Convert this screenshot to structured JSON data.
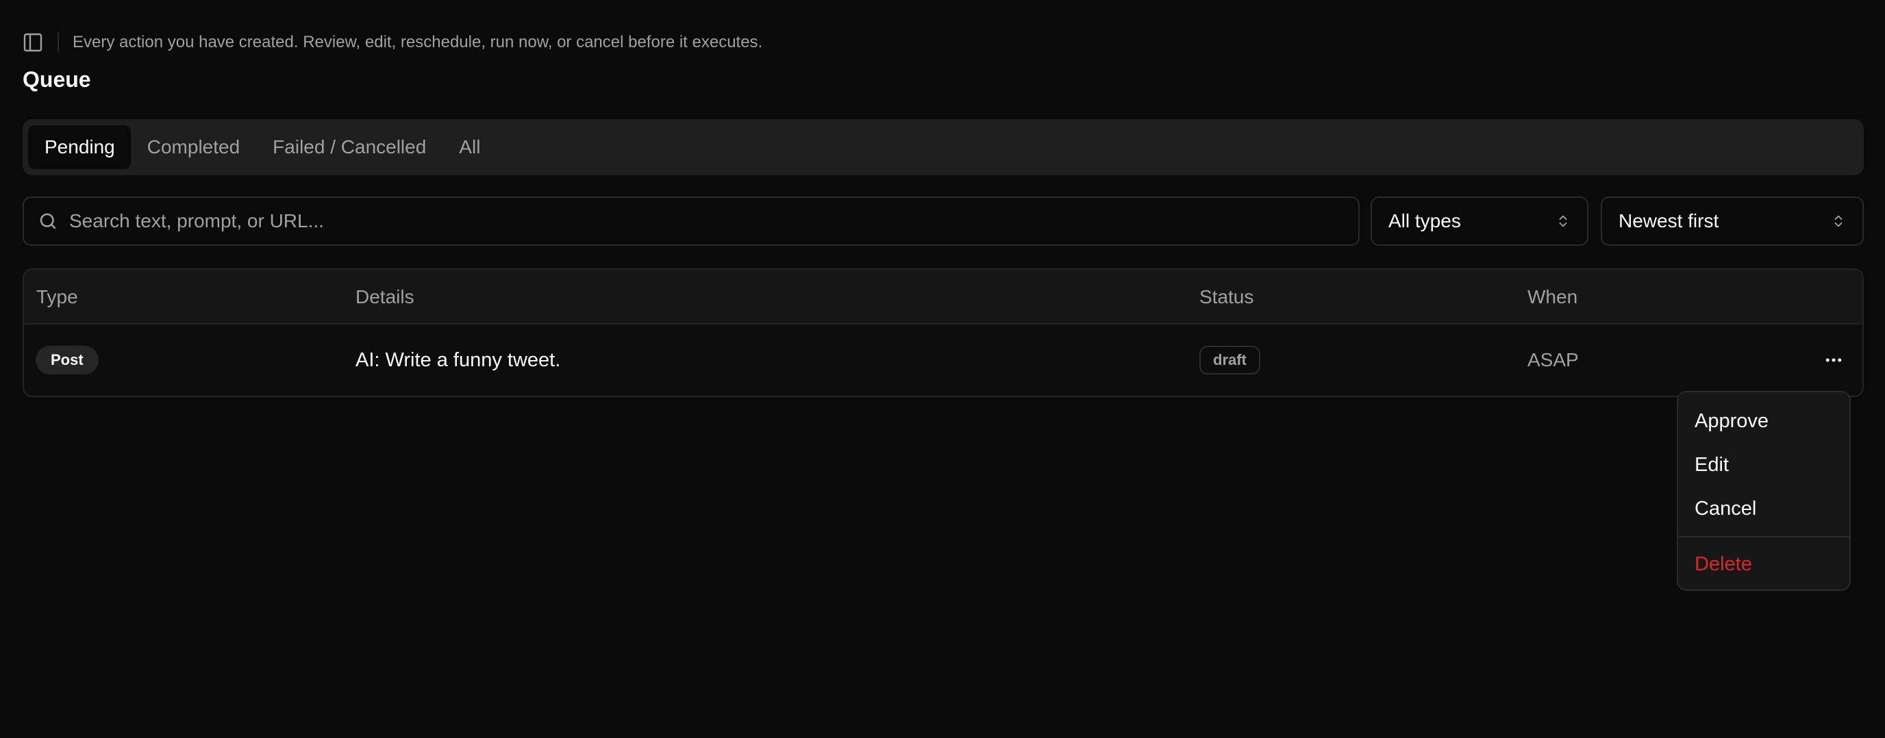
{
  "header": {
    "subtitle": "Every action you have created. Review, edit, reschedule, run now, or cancel before it executes.",
    "title": "Queue"
  },
  "tabs": [
    {
      "label": "Pending",
      "active": true
    },
    {
      "label": "Completed",
      "active": false
    },
    {
      "label": "Failed / Cancelled",
      "active": false
    },
    {
      "label": "All",
      "active": false
    }
  ],
  "filters": {
    "search_placeholder": "Search text, prompt, or URL...",
    "search_value": "",
    "type_select": "All types",
    "sort_select": "Newest first"
  },
  "table": {
    "columns": [
      "Type",
      "Details",
      "Status",
      "When"
    ],
    "rows": [
      {
        "type": "Post",
        "details": "AI: Write a funny tweet.",
        "status": "draft",
        "when": "ASAP"
      }
    ]
  },
  "row_menu": {
    "items": [
      "Approve",
      "Edit",
      "Cancel"
    ],
    "danger_item": "Delete"
  },
  "colors": {
    "background": "#0a0a0a",
    "danger": "#dc2626",
    "muted_text": "#a1a1a1"
  },
  "icons": {
    "sidebar_toggle": "panel-left-icon",
    "search": "search-icon",
    "select_chevrons": "chevrons-up-down-icon",
    "row_actions": "more-horizontal-icon"
  }
}
